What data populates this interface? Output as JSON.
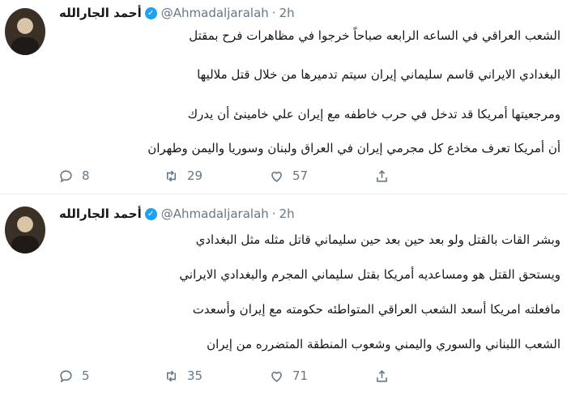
{
  "tweets": [
    {
      "author_name": "أحمد الجارالله",
      "handle": "@Ahmadaljaralah",
      "time": "2h",
      "lines": [
        "الشعب العراقي في الساعه الرابعه صباحاً خرجوا  في مظاهرات فرح بمقتل",
        "البغدادي الايراني قاسم سليماني  إيران سيتم تدميرها من خلال قتل ملاليها",
        "ومرجعيتها أمريكا قد تدخل في حرب خاطفه مع إيران علي خامينئ أن يدرك",
        "أن أمريكا تعرف مخادع كل مجرمي إيران في العراق ولبنان وسوريا واليمن وطهران"
      ],
      "replies": "8",
      "retweets": "29",
      "likes": "57"
    },
    {
      "author_name": "أحمد الجارالله",
      "handle": "@Ahmadaljaralah",
      "time": "2h",
      "lines": [
        "وبشر القات بالقتل ولو بعد حين  بعد حين  سليماني قاتل مثله مثل البغدادي",
        "ويستحق القتل هو ومساعديه أمريكا  بقتل سليماني المجرم والبغدادي الايراني",
        "مافعلته امريكا أسعد الشعب العراقي المتواطئه حكومته مع إيران وأسعدت",
        "الشعب اللبناني والسوري واليمني وشعوب المنطقة المتضرره من إيران"
      ],
      "replies": "5",
      "retweets": "35",
      "likes": "71"
    }
  ],
  "colors": {
    "verified": "#1da1f2",
    "muted": "#657786",
    "divider": "#e6ecf0"
  }
}
